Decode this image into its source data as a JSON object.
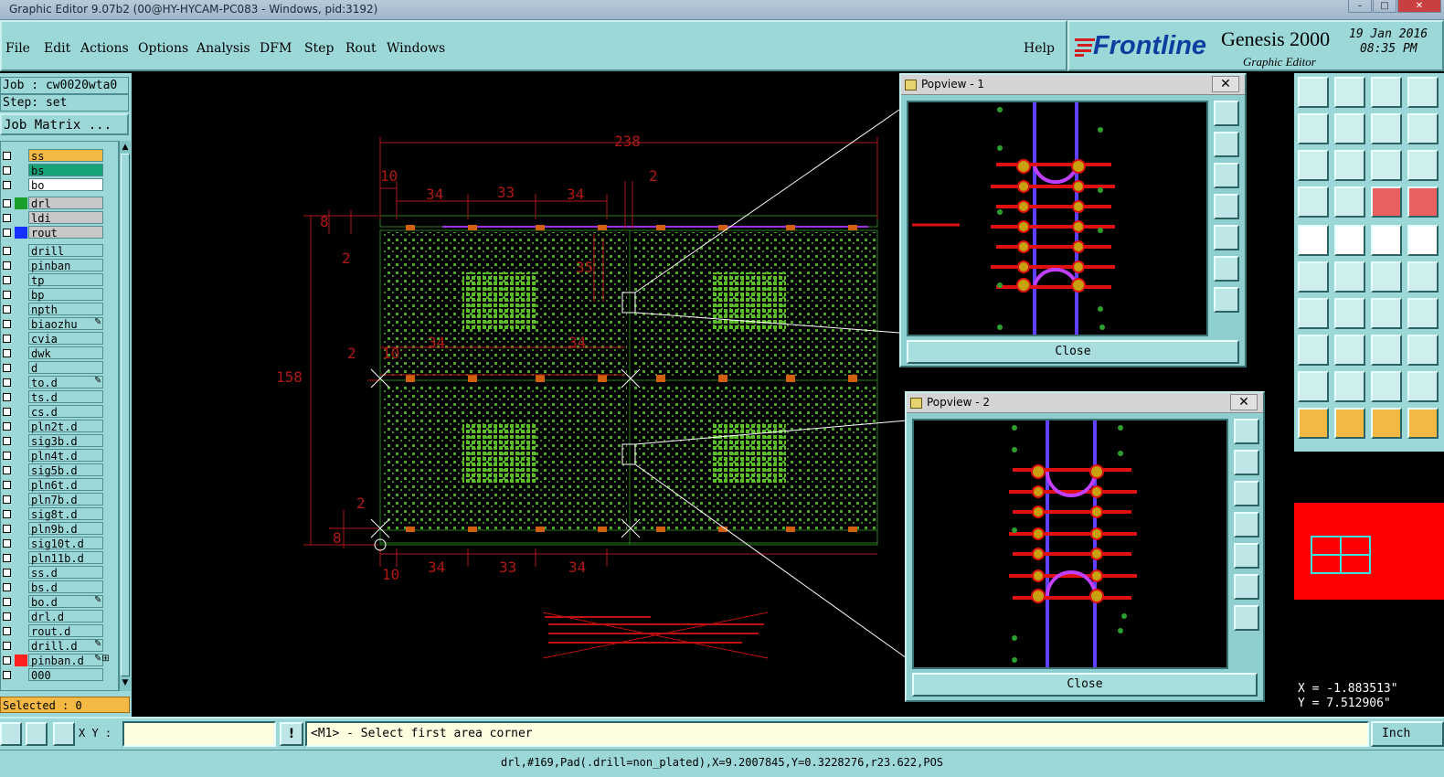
{
  "window": {
    "title": "Graphic Editor 9.07b2 (00@HY-HYCAM-PC083 - Windows, pid:3192)"
  },
  "menu": {
    "items": [
      "File",
      "Edit",
      "Actions",
      "Options",
      "Analysis",
      "DFM",
      "Step",
      "Rout",
      "Windows"
    ],
    "help": "Help"
  },
  "brand": {
    "logo": "Frontline",
    "product": "Genesis 2000",
    "subtitle": "Graphic Editor",
    "date": "19 Jan 2016",
    "time": "08:35 PM"
  },
  "job": {
    "job_line": "Job : cw0020wta0",
    "step_line": "Step: set",
    "matrix_button": "Job Matrix ..."
  },
  "layers": [
    {
      "name": "ss",
      "color": "#f4b945",
      "swatch": ""
    },
    {
      "name": "bs",
      "color": "#16a37a",
      "swatch": ""
    },
    {
      "name": "bo",
      "color": "#ffffff",
      "swatch": ""
    },
    {
      "name": "drl",
      "color": "#c8c8c8",
      "swatch": "#1aa02a"
    },
    {
      "name": "ldi",
      "color": "#c8c8c8",
      "swatch": ""
    },
    {
      "name": "rout",
      "color": "#c8c8c8",
      "swatch": "#1530ff"
    },
    {
      "name": "drill",
      "color": "#9dd8d9",
      "swatch": ""
    },
    {
      "name": "pinban",
      "color": "#9dd8d9",
      "swatch": ""
    },
    {
      "name": "tp",
      "color": "#9dd8d9",
      "swatch": ""
    },
    {
      "name": "bp",
      "color": "#9dd8d9",
      "swatch": ""
    },
    {
      "name": "npth",
      "color": "#9dd8d9",
      "swatch": ""
    },
    {
      "name": "biaozhu",
      "color": "#9dd8d9",
      "swatch": "",
      "flag": "✎"
    },
    {
      "name": "cvia",
      "color": "#9dd8d9",
      "swatch": ""
    },
    {
      "name": "dwk",
      "color": "#9dd8d9",
      "swatch": ""
    },
    {
      "name": "d",
      "color": "#9dd8d9",
      "swatch": ""
    },
    {
      "name": "to.d",
      "color": "#9dd8d9",
      "swatch": "",
      "flag": "✎"
    },
    {
      "name": "ts.d",
      "color": "#9dd8d9",
      "swatch": ""
    },
    {
      "name": "cs.d",
      "color": "#9dd8d9",
      "swatch": ""
    },
    {
      "name": "pln2t.d",
      "color": "#9dd8d9",
      "swatch": ""
    },
    {
      "name": "sig3b.d",
      "color": "#9dd8d9",
      "swatch": ""
    },
    {
      "name": "pln4t.d",
      "color": "#9dd8d9",
      "swatch": ""
    },
    {
      "name": "sig5b.d",
      "color": "#9dd8d9",
      "swatch": ""
    },
    {
      "name": "pln6t.d",
      "color": "#9dd8d9",
      "swatch": ""
    },
    {
      "name": "pln7b.d",
      "color": "#9dd8d9",
      "swatch": ""
    },
    {
      "name": "sig8t.d",
      "color": "#9dd8d9",
      "swatch": ""
    },
    {
      "name": "pln9b.d",
      "color": "#9dd8d9",
      "swatch": ""
    },
    {
      "name": "sig10t.d",
      "color": "#9dd8d9",
      "swatch": ""
    },
    {
      "name": "pln11b.d",
      "color": "#9dd8d9",
      "swatch": ""
    },
    {
      "name": "ss.d",
      "color": "#9dd8d9",
      "swatch": ""
    },
    {
      "name": "bs.d",
      "color": "#9dd8d9",
      "swatch": ""
    },
    {
      "name": "bo.d",
      "color": "#9dd8d9",
      "swatch": "",
      "flag": "✎"
    },
    {
      "name": "drl.d",
      "color": "#9dd8d9",
      "swatch": ""
    },
    {
      "name": "rout.d",
      "color": "#9dd8d9",
      "swatch": ""
    },
    {
      "name": "drill.d",
      "color": "#9dd8d9",
      "swatch": "",
      "flag": "✎"
    },
    {
      "name": "pinban.d",
      "color": "#9dd8d9",
      "swatch": "#ff2020",
      "flag": "✎⊞"
    },
    {
      "name": "000",
      "color": "#9dd8d9",
      "swatch": ""
    }
  ],
  "selected": "Selected : 0",
  "drawing": {
    "dims": [
      "238",
      "10",
      "2",
      "34",
      "33",
      "34",
      "8",
      "2",
      "35",
      "158",
      "2",
      "10",
      "34",
      "34",
      "2",
      "8",
      "10",
      "34",
      "33",
      "34"
    ]
  },
  "popview1": {
    "title": "Popview - 1",
    "close": "Close"
  },
  "popview2": {
    "title": "Popview - 2",
    "close": "Close"
  },
  "coords": {
    "x": "X = -1.883513\"",
    "y": "Y = 7.512906\""
  },
  "status": {
    "xy_label": "X Y :",
    "xy_value": "",
    "prompt": "<M1> - Select first area corner",
    "units": "Inch"
  },
  "info": "drl,#169,Pad(.drill=non_plated),X=9.2007845,Y=0.3228276,r23.622,POS"
}
